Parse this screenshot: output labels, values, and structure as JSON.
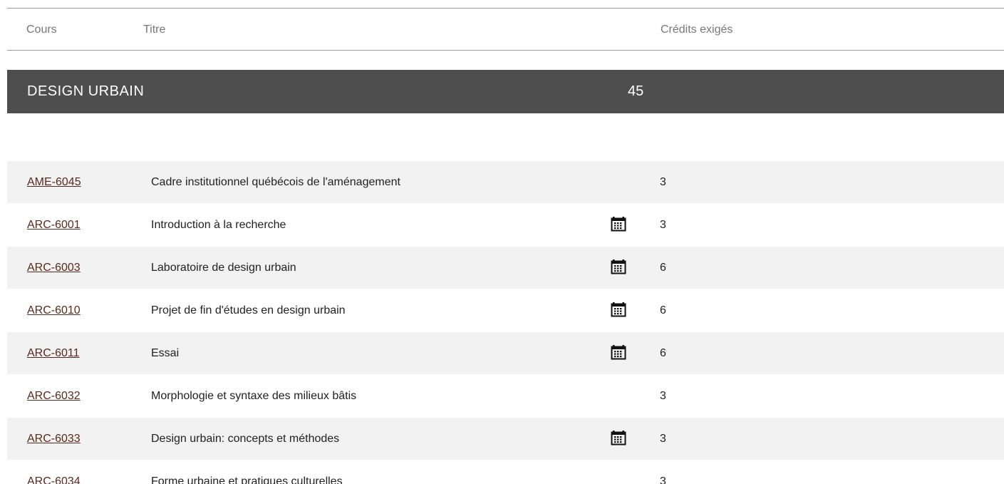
{
  "table_header": {
    "code_label": "Cours",
    "title_label": "Titre",
    "credits_label": "Crédits exigés"
  },
  "section": {
    "name": "DESIGN URBAIN",
    "credits": "45"
  },
  "courses": [
    {
      "code": "AME-6045",
      "title": "Cadre institutionnel québécois de l'aménagement",
      "credits": "3",
      "calendar": false
    },
    {
      "code": "ARC-6001",
      "title": "Introduction à la recherche",
      "credits": "3",
      "calendar": true
    },
    {
      "code": "ARC-6003",
      "title": "Laboratoire de design urbain",
      "credits": "6",
      "calendar": true
    },
    {
      "code": "ARC-6010",
      "title": "Projet de fin d'études en design urbain",
      "credits": "6",
      "calendar": true
    },
    {
      "code": "ARC-6011",
      "title": "Essai",
      "credits": "6",
      "calendar": true
    },
    {
      "code": "ARC-6032",
      "title": "Morphologie et syntaxe des milieux bâtis",
      "credits": "3",
      "calendar": false
    },
    {
      "code": "ARC-6033",
      "title": "Design urbain: concepts et méthodes",
      "credits": "3",
      "calendar": true
    },
    {
      "code": "ARC-6034",
      "title": "Forme urbaine et pratiques culturelles",
      "credits": "3",
      "calendar": false
    }
  ],
  "icons": {
    "calendar": "calendar-icon"
  },
  "colors": {
    "section_bar": "#4e4e4e",
    "link": "#5a2a1e",
    "row_alt": "#f2f2f2"
  }
}
